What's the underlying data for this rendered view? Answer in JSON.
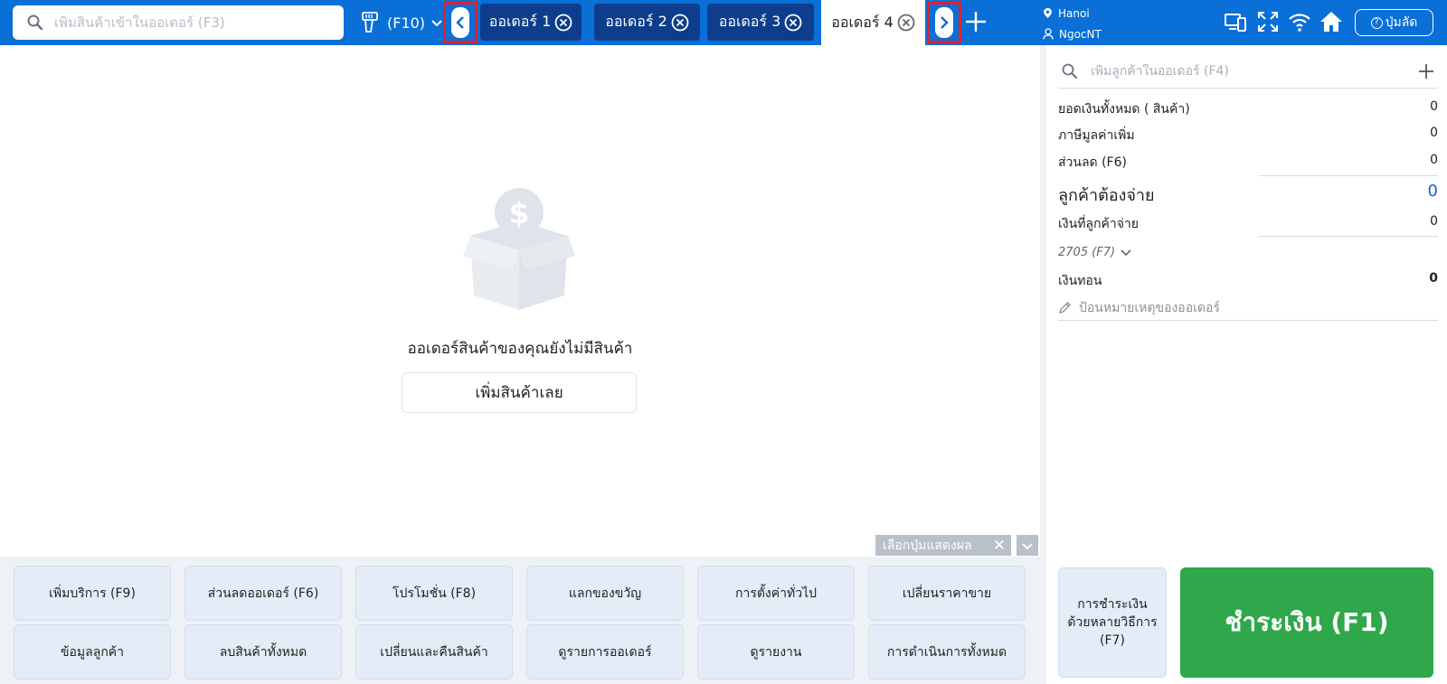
{
  "header": {
    "product_search_placeholder": "เพิ่มสินค้าเข้าในออเดอร์ (F3)",
    "barcode_label": "(F10)",
    "tabs": [
      {
        "label": "ออเดอร์ 1",
        "active": false
      },
      {
        "label": "ออเดอร์ 2",
        "active": false
      },
      {
        "label": "ออเดอร์ 3",
        "active": false
      },
      {
        "label": "ออเดอร์ 4",
        "active": true
      }
    ],
    "location": "Hanoi",
    "user": "NgocNT",
    "shortcut_label": "ปุ่มลัด",
    "icons": [
      "search-icon",
      "barcode-scanner-icon",
      "chevron-down-icon",
      "chevron-left-icon",
      "close-circle-icon",
      "chevron-right-icon",
      "plus-icon",
      "location-pin-icon",
      "user-icon",
      "device-sync-icon",
      "fullscreen-icon",
      "wifi-icon",
      "home-icon",
      "help-icon"
    ]
  },
  "cart": {
    "empty_message": "ออเดอร์สินค้าของคุณยังไม่มีสินค้า",
    "add_now_label": "เพิ่มสินค้าเลย",
    "display_chip_label": "เลือกปุ่มแสดงผล"
  },
  "actions": [
    "เพิ่มบริการ (F9)",
    "ส่วนลดออเดอร์ (F6)",
    "โปรโมชั่น (F8)",
    "แลกของขวัญ",
    "การตั้งค่าทั่วไป",
    "เปลี่ยนราคาขาย",
    "ข้อมูลลูกค้า",
    "ลบสินค้าทั้งหมด",
    "เปลี่ยนและคืนสินค้า",
    "ดูรายการออเดอร์",
    "ดูรายงาน",
    "การดำเนินการทั้งหมด"
  ],
  "summary": {
    "customer_search_placeholder": "เพิ่มลูกค้าในออเดอร์ (F4)",
    "total_label": "ยอดเงินทั้งหมด ( สินค้า)",
    "total_value": "0",
    "vat_label": "ภาษีมูลค่าเพิ่ม",
    "vat_value": "0",
    "discount_label": "ส่วนลด (F6)",
    "discount_value": "0",
    "to_pay_label": "ลูกค้าต้องจ่าย",
    "to_pay_value": "0",
    "paid_label": "เงินที่ลูกค้าจ่าย",
    "paid_value": "0",
    "payment_method": "2705 (F7)",
    "change_label": "เงินทอน",
    "change_value": "0",
    "note_placeholder": "ป้อนหมายเหตุของออเดอร์",
    "multi_pay_label": "การชำระเงินด้วยหลายวิธีการ (F7)",
    "pay_label": "ชำระเงิน (F1)"
  },
  "colors": {
    "header_bg": "#0a6fd6",
    "tab_bg": "#0d3d8c",
    "pay_green": "#2ea84a",
    "action_bg": "#e4ecf8",
    "accent_blue": "#1a5fd0",
    "nav_highlight": "#e1202a"
  }
}
